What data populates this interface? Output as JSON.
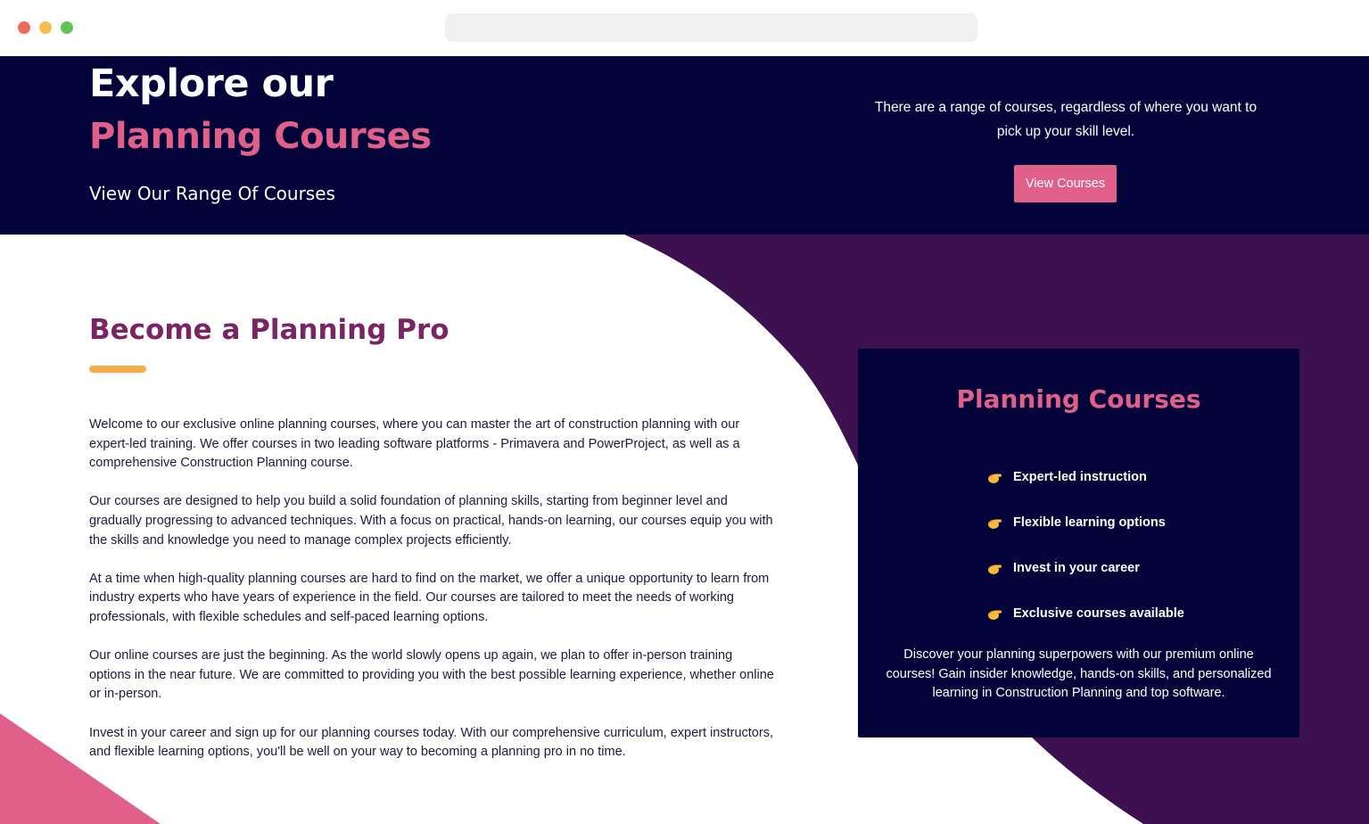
{
  "hero": {
    "title_line1": "Explore our",
    "title_line2": "Planning Courses",
    "subtitle": "View Our Range Of Courses",
    "description": "There are a range of courses, regardless of where you want to pick up your skill level.",
    "button_label": "View Courses"
  },
  "main": {
    "heading": "Become a Planning Pro",
    "paragraphs": [
      "Welcome to our exclusive online planning courses, where you can master the art of construction planning with our expert-led training. We offer courses in two leading software platforms - Primavera and PowerProject, as well as a comprehensive Construction Planning course.",
      "Our courses are designed to help you build a solid foundation of planning skills, starting from beginner level and gradually progressing to advanced techniques. With a focus on practical, hands-on learning, our courses equip you with the skills and knowledge you need to manage complex projects efficiently.",
      "At a time when high-quality planning courses are hard to find on the market, we offer a unique opportunity to learn from industry experts who have years of experience in the field. Our courses are tailored to meet the needs of working professionals, with flexible schedules and self-paced learning options.",
      "Our online courses are just the beginning. As the world slowly opens up again, we plan to offer in-person training options in the near future. We are committed to providing you with the best possible learning experience, whether online or in-person.",
      "Invest in your career and sign up for our planning courses today. With our comprehensive curriculum, expert instructors, and flexible learning options, you'll be well on your way to becoming a planning pro in no time."
    ]
  },
  "card": {
    "title": "Planning Courses",
    "feature_icon": "pointing-hand-icon",
    "features": [
      "Expert-led instruction",
      "Flexible learning options",
      "Invest in your career",
      "Exclusive courses available"
    ],
    "text": "Discover your planning superpowers with our premium online courses! Gain insider knowledge, hands-on skills, and personalized learning in Construction Planning and top software."
  },
  "colors": {
    "navy": "#03033a",
    "pink": "#e0608a",
    "purple": "#3d1150",
    "heading_purple": "#7a2463",
    "accent_orange": "#f6ad4b"
  }
}
